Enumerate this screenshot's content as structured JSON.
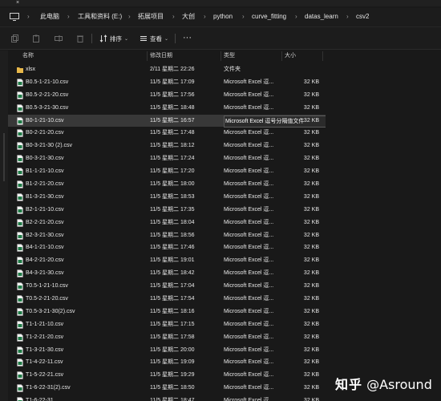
{
  "address_bar": {
    "crumbs": [
      "此电脑",
      "工具和资料 (E:)",
      "拓展项目",
      "大创",
      "python",
      "curve_fitting",
      "datas_learn",
      "csv2"
    ]
  },
  "toolbar": {
    "sort_label": "排序",
    "view_label": "查看",
    "more_label": "···"
  },
  "columns": {
    "name": "名称",
    "date": "修改日期",
    "type": "类型",
    "size": "大小"
  },
  "tooltip_type": "Microsoft Excel 逗号分隔值文件",
  "files": [
    {
      "name": "xlsx",
      "date": "2/11 星期二 22:26",
      "type": "文件夹",
      "size": "",
      "kind": "folder"
    },
    {
      "name": "B0.5-1-21-10.csv",
      "date": "11/5 星期二 17:09",
      "type": "Microsoft Excel 逗...",
      "size": "32 KB",
      "kind": "csv"
    },
    {
      "name": "B0.5-2-21-20.csv",
      "date": "11/5 星期二 17:56",
      "type": "Microsoft Excel 逗...",
      "size": "32 KB",
      "kind": "csv"
    },
    {
      "name": "B0.5-3-21-30.csv",
      "date": "11/5 星期二 18:48",
      "type": "Microsoft Excel 逗...",
      "size": "32 KB",
      "kind": "csv"
    },
    {
      "name": "B0-1-21-10.csv",
      "date": "11/5 星期二 16:57",
      "type": "Microsoft Excel 逗号分隔值文件",
      "size": "32 KB",
      "kind": "csv",
      "selected": true
    },
    {
      "name": "B0-2-21-20.csv",
      "date": "11/5 星期二 17:48",
      "type": "Microsoft Excel 逗...",
      "size": "32 KB",
      "kind": "csv"
    },
    {
      "name": "B0-3-21-30 (2).csv",
      "date": "11/5 星期二 18:12",
      "type": "Microsoft Excel 逗...",
      "size": "32 KB",
      "kind": "csv"
    },
    {
      "name": "B0-3-21-30.csv",
      "date": "11/5 星期二 17:24",
      "type": "Microsoft Excel 逗...",
      "size": "32 KB",
      "kind": "csv"
    },
    {
      "name": "B1-1-21-10.csv",
      "date": "11/5 星期二 17:20",
      "type": "Microsoft Excel 逗...",
      "size": "32 KB",
      "kind": "csv"
    },
    {
      "name": "B1-2-21-20.csv",
      "date": "11/5 星期二 18:00",
      "type": "Microsoft Excel 逗...",
      "size": "32 KB",
      "kind": "csv"
    },
    {
      "name": "B1-3-21-30.csv",
      "date": "11/5 星期二 18:53",
      "type": "Microsoft Excel 逗...",
      "size": "32 KB",
      "kind": "csv"
    },
    {
      "name": "B2-1-21-10.csv",
      "date": "11/5 星期二 17:35",
      "type": "Microsoft Excel 逗...",
      "size": "32 KB",
      "kind": "csv"
    },
    {
      "name": "B2-2-21-20.csv",
      "date": "11/5 星期二 18:04",
      "type": "Microsoft Excel 逗...",
      "size": "32 KB",
      "kind": "csv"
    },
    {
      "name": "B2-3-21-30.csv",
      "date": "11/5 星期二 18:56",
      "type": "Microsoft Excel 逗...",
      "size": "32 KB",
      "kind": "csv"
    },
    {
      "name": "B4-1-21-10.csv",
      "date": "11/5 星期二 17:46",
      "type": "Microsoft Excel 逗...",
      "size": "32 KB",
      "kind": "csv"
    },
    {
      "name": "B4-2-21-20.csv",
      "date": "11/5 星期二 19:01",
      "type": "Microsoft Excel 逗...",
      "size": "32 KB",
      "kind": "csv"
    },
    {
      "name": "B4-3-21-30.csv",
      "date": "11/5 星期二 18:42",
      "type": "Microsoft Excel 逗...",
      "size": "32 KB",
      "kind": "csv"
    },
    {
      "name": "T0.5-1-21-10.csv",
      "date": "11/5 星期二 17:04",
      "type": "Microsoft Excel 逗...",
      "size": "32 KB",
      "kind": "csv"
    },
    {
      "name": "T0.5-2-21-20.csv",
      "date": "11/5 星期二 17:54",
      "type": "Microsoft Excel 逗...",
      "size": "32 KB",
      "kind": "csv"
    },
    {
      "name": "T0.5-3-21-30(2).csv",
      "date": "11/5 星期二 18:16",
      "type": "Microsoft Excel 逗...",
      "size": "32 KB",
      "kind": "csv"
    },
    {
      "name": "T1-1-21-10.csv",
      "date": "11/5 星期二 17:15",
      "type": "Microsoft Excel 逗...",
      "size": "32 KB",
      "kind": "csv"
    },
    {
      "name": "T1-2-21-20.csv",
      "date": "11/5 星期二 17:58",
      "type": "Microsoft Excel 逗...",
      "size": "32 KB",
      "kind": "csv"
    },
    {
      "name": "T1-3-21-30.csv",
      "date": "11/5 星期二 20:00",
      "type": "Microsoft Excel 逗...",
      "size": "32 KB",
      "kind": "csv"
    },
    {
      "name": "T1-4-22-11.csv",
      "date": "11/5 星期二 19:09",
      "type": "Microsoft Excel 逗...",
      "size": "32 KB",
      "kind": "csv"
    },
    {
      "name": "T1-5-22-21.csv",
      "date": "11/5 星期二 19:29",
      "type": "Microsoft Excel 逗...",
      "size": "32 KB",
      "kind": "csv"
    },
    {
      "name": "T1-6-22-31(2).csv",
      "date": "11/5 星期二 18:50",
      "type": "Microsoft Excel 逗...",
      "size": "32 KB",
      "kind": "csv"
    },
    {
      "name": "T1-6-22-31",
      "date": "11/5 星期二 18:47",
      "type": "Microsoft Excel 逗...",
      "size": "32 KB",
      "kind": "csv"
    }
  ],
  "watermark": {
    "logo": "知乎",
    "handle": "@Asround"
  }
}
